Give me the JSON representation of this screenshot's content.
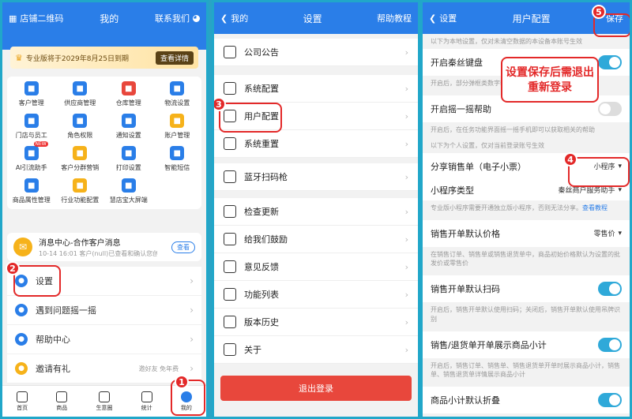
{
  "panel1": {
    "qr_label": "店铺二维码",
    "title": "我的",
    "contact": "联系我们",
    "vip_text": "专业版将于2029年8月25日到期",
    "vip_button": "查看详情",
    "grid": [
      {
        "label": "客户管理",
        "icon": "person-icon",
        "color": "#2a7ee8"
      },
      {
        "label": "供应商管理",
        "icon": "cube-icon",
        "color": "#2a7ee8"
      },
      {
        "label": "仓库管理",
        "icon": "house-icon",
        "color": "#e8473c"
      },
      {
        "label": "物流设置",
        "icon": "truck-icon",
        "color": "#2a7ee8"
      },
      {
        "label": "门店与员工",
        "icon": "store-icon",
        "color": "#2a7ee8"
      },
      {
        "label": "角色权限",
        "icon": "role-icon",
        "color": "#2a7ee8"
      },
      {
        "label": "通知设置",
        "icon": "bell-icon",
        "color": "#2a7ee8"
      },
      {
        "label": "账户管理",
        "icon": "account-icon",
        "color": "#f6b21a"
      },
      {
        "label": "AI引流助手",
        "icon": "ai-icon",
        "color": "#2a7ee8"
      },
      {
        "label": "客户分群营销",
        "icon": "group-icon",
        "color": "#f6b21a"
      },
      {
        "label": "打印设置",
        "icon": "printer-icon",
        "color": "#2a7ee8"
      },
      {
        "label": "智能短信",
        "icon": "sms-icon",
        "color": "#2a7ee8"
      },
      {
        "label": "商品属性管理",
        "icon": "tag-icon",
        "color": "#2a7ee8"
      },
      {
        "label": "行业功能配置",
        "icon": "config-icon",
        "color": "#f6b21a"
      },
      {
        "label": "慧店宝大屏端",
        "icon": "screen-icon",
        "color": "#2a7ee8"
      }
    ],
    "message_title": "消息中心-合作客户消息",
    "message_time": "10-14 16:01",
    "message_body": "客户(null)已查看和确认您创建...",
    "message_button": "查看",
    "menu": [
      {
        "label": "设置",
        "color": "#2a7ee8",
        "sub": ""
      },
      {
        "label": "遇到问题摇一摇",
        "color": "#2a7ee8",
        "sub": ""
      },
      {
        "label": "帮助中心",
        "color": "#2a7ee8",
        "sub": ""
      },
      {
        "label": "邀请有礼",
        "color": "#f6b21a",
        "sub": "邀好友 免年费"
      }
    ],
    "tabs": [
      "首页",
      "商品",
      "生意圈",
      "统计",
      "我的"
    ],
    "badges": [
      "1",
      "2"
    ]
  },
  "panel2": {
    "back": "我的",
    "title": "设置",
    "help": "帮助教程",
    "groups": [
      [
        "公司公告"
      ],
      [
        "系统配置",
        "用户配置",
        "系统重置"
      ],
      [
        "蓝牙扫码枪"
      ],
      [
        "检查更新",
        "给我们鼓励",
        "意见反馈",
        "功能列表",
        "版本历史",
        "关于"
      ]
    ],
    "logout": "退出登录",
    "badge": "3"
  },
  "panel3": {
    "back": "设置",
    "title": "用户配置",
    "save": "保存",
    "note_top": "以下为本地设置，仅对未清空数据的本设备本账号生效",
    "row_keyboard": "开启秦丝键盘",
    "note_keyboard": "开启后，部分弹框类数字输入...",
    "row_shake": "开启摇一摇帮助",
    "note_shake": "开启后，在任务功能界面摇一摇手机即可以获取相关的帮助",
    "note_personal": "以下为个人设置，仅对当前登录账号生效",
    "row_share": "分享销售单（电子小票）",
    "share_value": "小程序",
    "row_mini": "小程序类型",
    "mini_value": "秦丝商户服务助手",
    "note_mini": "专业版小程序需要开通独立版小程序，否则无法分享。",
    "note_mini_link": "查看教程",
    "row_price": "销售开单默认价格",
    "price_value": "零售价",
    "note_price": "在销售订单、销售单或销售退货单中，商品初始价格默认为设置的批发价或零售价",
    "row_scan": "销售开单默认扫码",
    "note_scan": "开启后，销售开单默认使用扫码；关闭后，销售开单默认使用吊牌识别",
    "row_subtotal": "销售/退货单开单展示商品小计",
    "note_subtotal": "开启后，销售订单、销售单、销售退货单开单时展示商品小计，销售单、销售退货单详情展示商品小计",
    "row_fold": "商品小计默认折叠",
    "callout": "设置保存后需退出重新登录",
    "badges": [
      "4",
      "5"
    ]
  }
}
